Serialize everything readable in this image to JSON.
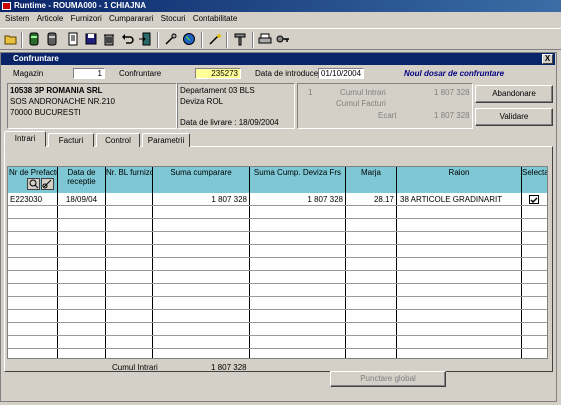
{
  "window": {
    "title": "Runtime - ROUMA000 -  1  CHIAJNA"
  },
  "menu": [
    "Sistem",
    "Articole",
    "Furnizori",
    "Cumpararari",
    "Stocuri",
    "Contabilitate"
  ],
  "child": {
    "title": "Confruntare",
    "close": "X"
  },
  "header": {
    "magazin_label": "Magazin",
    "magazin_value": "1",
    "confruntare_label": "Confruntare",
    "confruntare_value": "235273",
    "date_label": "Data de introduce",
    "date_value": "01/10/2004",
    "banner": "Noul dosar de confruntare"
  },
  "supplier": {
    "name": "10538 3P ROMANIA SRL",
    "address": "SOS ANDRONACHE NR.210",
    "city": "70000 BUCURESTI"
  },
  "dept": {
    "department": "Departament 03 BLS",
    "currency": "Deviza ROL",
    "delivery": "Data de livrare : 18/09/2004"
  },
  "totals": {
    "index": "1",
    "intrari_label": "Cumul Intrari",
    "intrari_value": "1 807 328",
    "facturi_label": "Cumul Facturi",
    "ecart_label": "Ecart",
    "ecart_value": "1 807 328"
  },
  "buttons": {
    "abandon": "Abandonare",
    "validate": "Validare",
    "global": "Punctare global"
  },
  "tabs": [
    "Intrari",
    "Facturi",
    "Control",
    "Parametrii"
  ],
  "grid": {
    "columns": [
      "Nr de Prefactura",
      "Data de receptie",
      "Nr. BL furnizo",
      "Suma cumparare",
      "Suma Cump. Deviza Frs",
      "Marja",
      "Raion",
      "Selectare"
    ],
    "rows": [
      {
        "prefactura": "E223030",
        "data": "18/09/04",
        "bl": "",
        "suma": "1 807 328",
        "suma_deviza": "1 807 328",
        "marja": "28.17",
        "raion": "38  ARTICOLE GRADINARIT",
        "selected": true
      }
    ]
  },
  "footer": {
    "label": "Cumul Intrari",
    "value": "1 807 328"
  }
}
